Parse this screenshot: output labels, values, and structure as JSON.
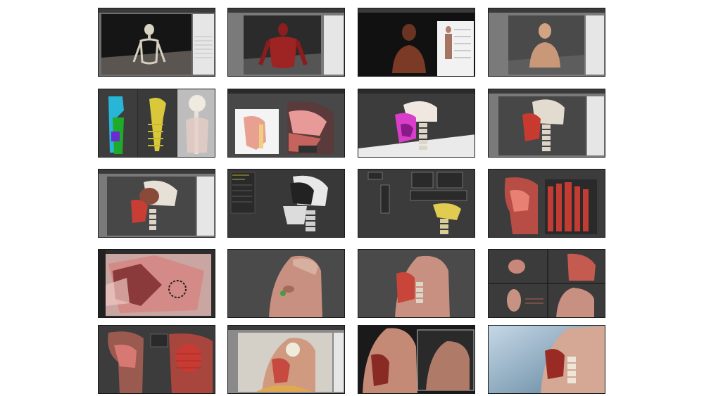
{
  "gallery": {
    "rows": 5,
    "columns": 4,
    "tiles": [
      {
        "id": "r1c1",
        "subject": "skeleton",
        "view": "3ds-max-viewport"
      },
      {
        "id": "r1c2",
        "subject": "muscle-torso",
        "view": "3ds-max-viewport"
      },
      {
        "id": "r1c3",
        "subject": "bust-with-reference-chart",
        "view": "viewport-with-reference"
      },
      {
        "id": "r1c4",
        "subject": "skin-bust",
        "view": "3ds-max-viewport"
      },
      {
        "id": "r2c1",
        "subject": "spine-wireframes",
        "view": "three-panel"
      },
      {
        "id": "r2c2",
        "subject": "head-section-reference",
        "view": "reference-and-model"
      },
      {
        "id": "r2c3",
        "subject": "head-section-colored",
        "view": "viewport"
      },
      {
        "id": "r2c4",
        "subject": "head-section-render",
        "view": "3ds-max-viewport"
      },
      {
        "id": "r3c1",
        "subject": "skull-section",
        "view": "3ds-max-viewport"
      },
      {
        "id": "r3c2",
        "subject": "skull-side",
        "view": "viewport-with-panels"
      },
      {
        "id": "r3c3",
        "subject": "spine-rig",
        "view": "viewport-with-panels"
      },
      {
        "id": "r3c4",
        "subject": "mouth-section-slices",
        "view": "viewport"
      },
      {
        "id": "r4c1",
        "subject": "texture-painting",
        "view": "paint-editor"
      },
      {
        "id": "r4c2",
        "subject": "elder-head",
        "view": "viewport"
      },
      {
        "id": "r4c3",
        "subject": "elder-head-section",
        "view": "viewport"
      },
      {
        "id": "r4c4",
        "subject": "multi-view-heads",
        "view": "viewport-grid"
      },
      {
        "id": "r5c1",
        "subject": "throat-section",
        "view": "viewport"
      },
      {
        "id": "r5c2",
        "subject": "head-render-window",
        "view": "3ds-max-viewport"
      },
      {
        "id": "r5c3",
        "subject": "elder-head-render",
        "view": "final-render"
      },
      {
        "id": "r5c4",
        "subject": "mouth-closeup",
        "view": "final-render"
      }
    ]
  }
}
